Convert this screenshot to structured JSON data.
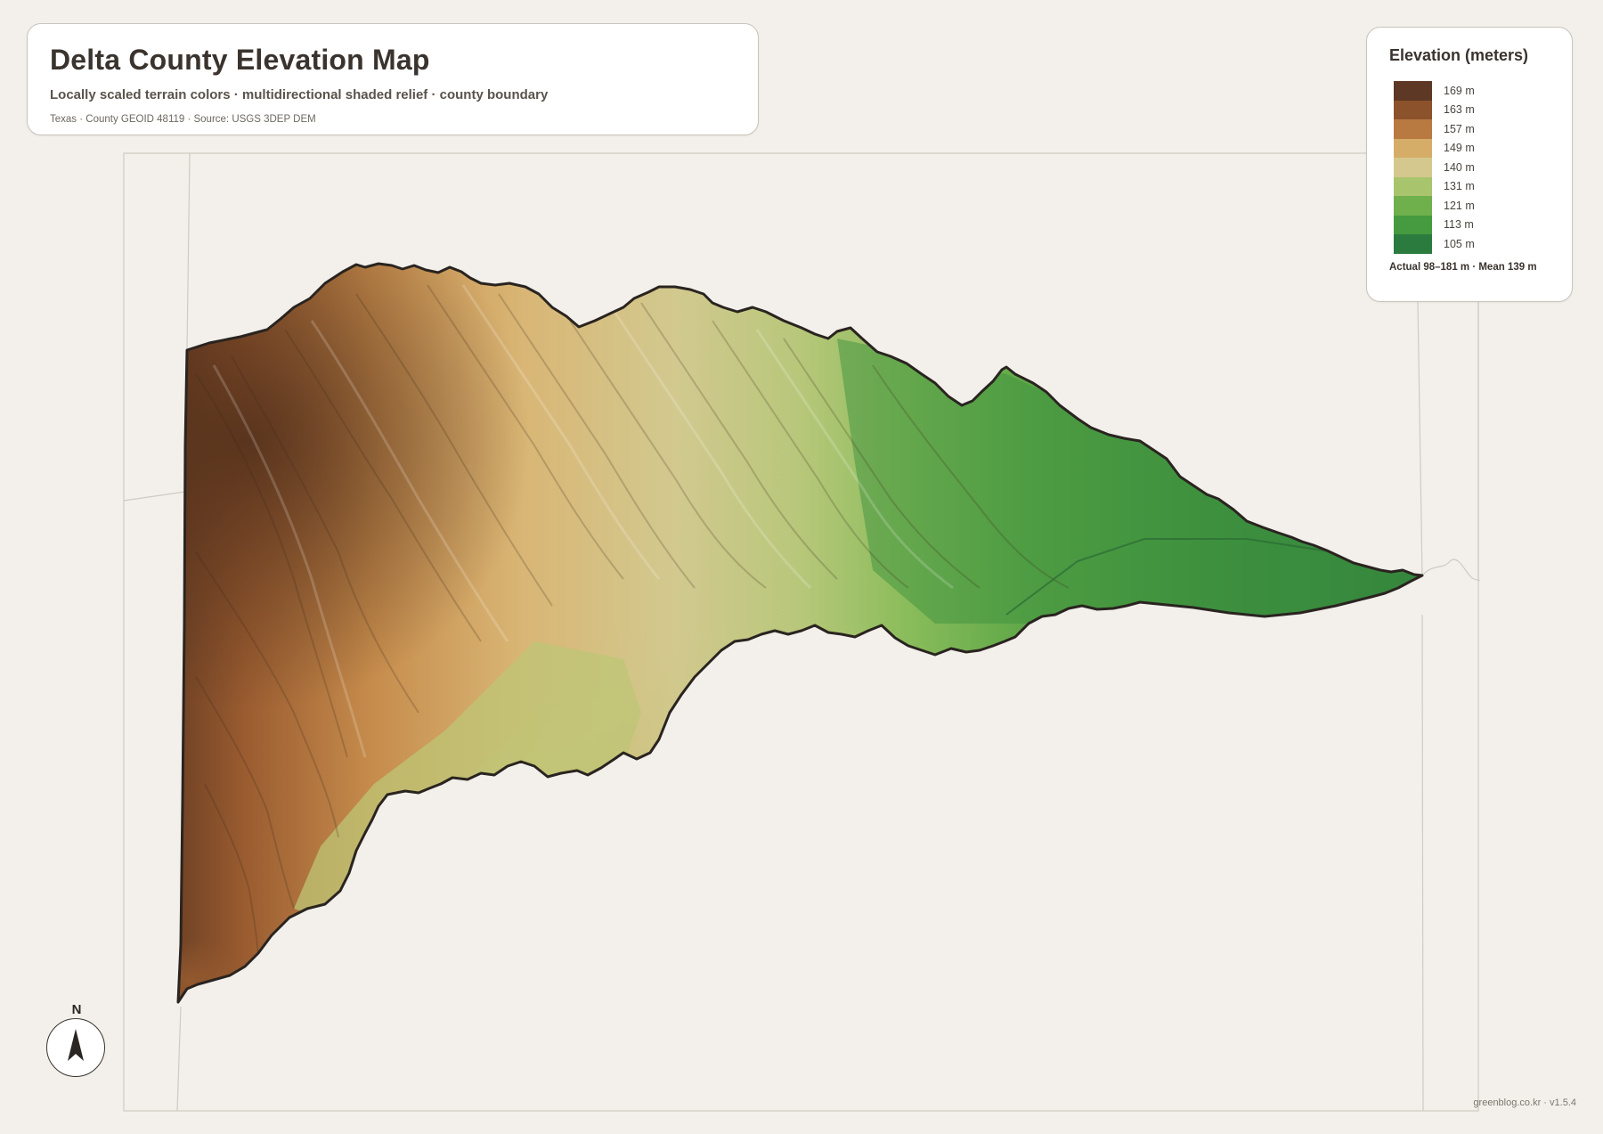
{
  "header": {
    "title": "Delta County Elevation Map",
    "subtitle": "Locally scaled terrain colors · multidirectional shaded relief · county boundary",
    "meta": "Texas · County GEOID 48119 · Source: USGS 3DEP DEM"
  },
  "legend": {
    "title": "Elevation (meters)",
    "items": [
      {
        "label": "169 m",
        "color": "#5d3825"
      },
      {
        "label": "163 m",
        "color": "#8b522c"
      },
      {
        "label": "157 m",
        "color": "#b97a42"
      },
      {
        "label": "149 m",
        "color": "#d6ad68"
      },
      {
        "label": "140 m",
        "color": "#d4c88e"
      },
      {
        "label": "131 m",
        "color": "#a8c46c"
      },
      {
        "label": "121 m",
        "color": "#6fb04d"
      },
      {
        "label": "113 m",
        "color": "#469a3f"
      },
      {
        "label": "105 m",
        "color": "#2c7b3e"
      }
    ],
    "stats": "Actual 98–181 m · Mean 139 m"
  },
  "north_arrow": {
    "label": "N"
  },
  "credit": "greenblog.co.kr · v1.5.4",
  "colors": {
    "background": "#f3f0eb",
    "frame_line": "#cfcac2",
    "county_outline": "#2a2420",
    "high": "#5d3825",
    "low": "#2c7b3e"
  }
}
